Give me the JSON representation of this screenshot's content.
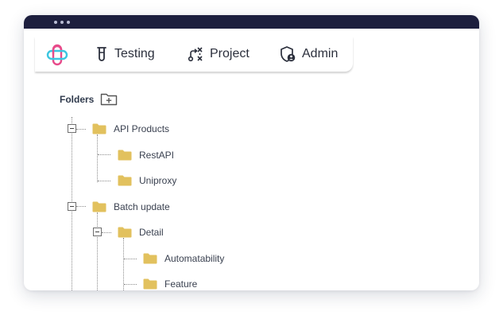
{
  "colors": {
    "titlebar": "#1d1f3e",
    "folder": "#e2c15e",
    "text": "#3a4150",
    "logo_pink": "#e84b8a",
    "logo_blue": "#3cc6e0"
  },
  "nav": {
    "logo_icon": "plus-logo-icon",
    "items": [
      {
        "label": "Testing",
        "icon": "test-tube-icon"
      },
      {
        "label": "Project",
        "icon": "workflow-icon"
      },
      {
        "label": "Admin",
        "icon": "shield-user-icon"
      }
    ]
  },
  "folders": {
    "title": "Folders",
    "add_icon": "add-folder-icon",
    "tree": [
      {
        "label": "API Products",
        "expanded": true,
        "children": [
          {
            "label": "RestAPI"
          },
          {
            "label": "Uniproxy"
          }
        ]
      },
      {
        "label": "Batch update",
        "expanded": true,
        "children": [
          {
            "label": "Detail",
            "expanded": true,
            "children": [
              {
                "label": "Automatability"
              },
              {
                "label": "Feature"
              }
            ]
          }
        ]
      }
    ]
  }
}
